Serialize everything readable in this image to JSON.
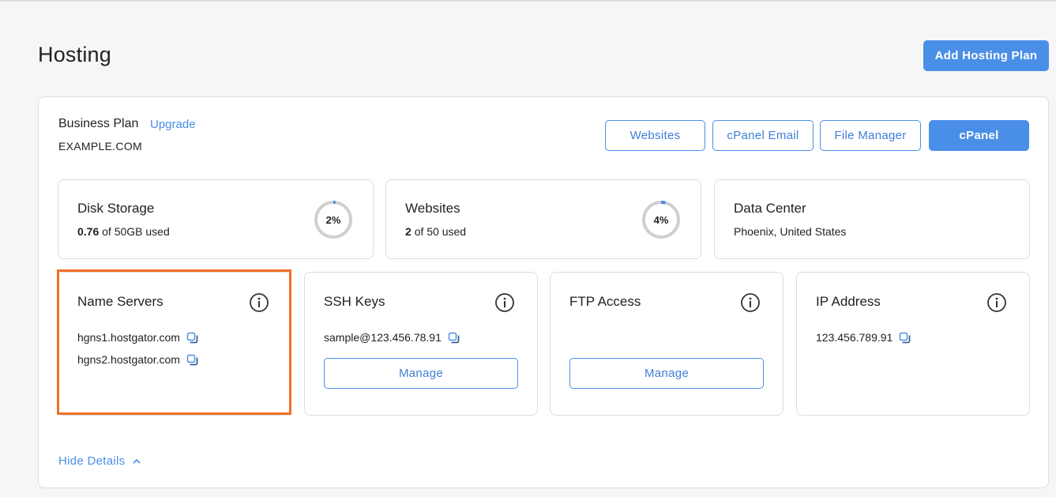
{
  "page": {
    "title": "Hosting"
  },
  "header": {
    "add_plan_label": "Add Hosting Plan"
  },
  "plan": {
    "name": "Business Plan",
    "upgrade_label": "Upgrade",
    "domain": "EXAMPLE.COM",
    "actions": {
      "websites": "Websites",
      "cpanel_email": "cPanel Email",
      "file_manager": "File Manager",
      "cpanel": "cPanel"
    }
  },
  "stats": {
    "disk": {
      "title": "Disk Storage",
      "used": "0.76",
      "suffix": "of 50GB used",
      "percent_label": "2%",
      "percent": 2
    },
    "websites": {
      "title": "Websites",
      "used": "2",
      "suffix": "of 50 used",
      "percent_label": "4%",
      "percent": 4
    },
    "datacenter": {
      "title": "Data Center",
      "location": "Phoenix, United States"
    }
  },
  "details": {
    "name_servers": {
      "title": "Name Servers",
      "items": [
        "hgns1.hostgator.com",
        "hgns2.hostgator.com"
      ]
    },
    "ssh_keys": {
      "title": "SSH Keys",
      "value": "sample@123.456.78.91",
      "manage_label": "Manage"
    },
    "ftp_access": {
      "title": "FTP Access",
      "manage_label": "Manage"
    },
    "ip_address": {
      "title": "IP Address",
      "value": "123.456.789.91"
    }
  },
  "footer": {
    "hide_details_label": "Hide Details"
  },
  "colors": {
    "accent": "#4a8fe7",
    "highlight": "#f07028",
    "gauge_track": "#d0d0d0"
  }
}
